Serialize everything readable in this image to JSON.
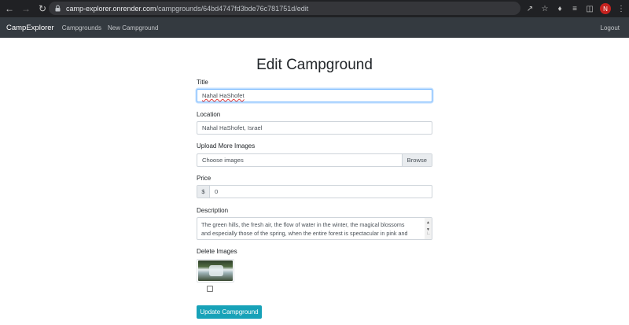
{
  "browser": {
    "url_host": "camp-explorer.onrender.com",
    "url_path": "/campgrounds/64bd4747fd3bde76c781751d/edit",
    "profile_initial": "N"
  },
  "navbar": {
    "brand": "CampExplorer",
    "links": [
      "Campgrounds",
      "New Campground"
    ],
    "logout": "Logout"
  },
  "form": {
    "heading": "Edit Campground",
    "title_label": "Title",
    "title_value": "Nahal HaShofet",
    "location_label": "Location",
    "location_value": "Nahal HaShofet, Israel",
    "upload_label": "Upload More Images",
    "upload_placeholder": "Choose images",
    "browse_label": "Browse",
    "price_label": "Price",
    "price_prefix": "$",
    "price_value": "0",
    "description_label": "Description",
    "description_line1": "The green hills, the fresh air, the flow of water in the winter, the magical blossoms",
    "description_line2": "and especially those of the spring, when the entire forest is spectacular in pink and",
    "delete_label": "Delete Images",
    "submit_label": "Update Campground"
  }
}
